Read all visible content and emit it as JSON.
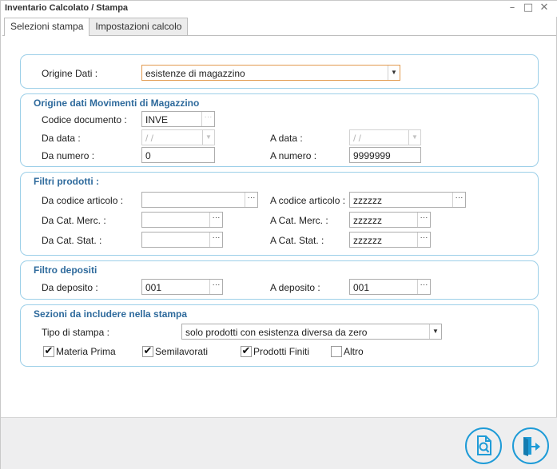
{
  "window": {
    "title": "Inventario Calcolato / Stampa",
    "minimize": "–",
    "maximize": "□",
    "close": "✕"
  },
  "tabs": [
    {
      "label": "Selezioni stampa",
      "active": true
    },
    {
      "label": "Impostazioni calcolo",
      "active": false
    }
  ],
  "origine": {
    "label": "Origine Dati :",
    "value": "esistenze di magazzino"
  },
  "movimenti": {
    "title": "Origine dati Movimenti di Magazzino",
    "codice_label": "Codice documento :",
    "codice_value": "INVE",
    "da_data_label": "Da data :",
    "da_data_value": " /  /",
    "a_data_label": "A data :",
    "a_data_value": " /  /",
    "da_numero_label": "Da numero :",
    "da_numero_value": "0",
    "a_numero_label": "A numero :",
    "a_numero_value": "9999999"
  },
  "filtri": {
    "title": "Filtri prodotti :",
    "da_cod_label": "Da codice articolo :",
    "da_cod_value": "",
    "a_cod_label": "A codice articolo :",
    "a_cod_value": "zzzzzz",
    "da_merc_label": "Da Cat. Merc. :",
    "da_merc_value": "",
    "a_merc_label": "A Cat. Merc. :",
    "a_merc_value": "zzzzzz",
    "da_stat_label": "Da Cat. Stat. :",
    "da_stat_value": "",
    "a_stat_label": "A Cat. Stat. :",
    "a_stat_value": "zzzzzz"
  },
  "depositi": {
    "title": "Filtro depositi",
    "da_label": "Da deposito :",
    "da_value": "001",
    "a_label": "A deposito :",
    "a_value": "001"
  },
  "sezioni": {
    "title": "Sezioni da includere nella stampa",
    "tipo_label": "Tipo di stampa :",
    "tipo_value": "solo prodotti con esistenza diversa da zero",
    "checks": [
      {
        "label": "Materia Prima",
        "checked": true
      },
      {
        "label": "Semilavorati",
        "checked": true
      },
      {
        "label": "Prodotti Finiti",
        "checked": true
      },
      {
        "label": "Altro",
        "checked": false
      }
    ]
  },
  "glyphs": {
    "dots": "···",
    "arrow": "▼",
    "check": "✔"
  },
  "footer": {
    "preview_icon": "print-preview-icon",
    "exit_icon": "exit-icon",
    "accent": "#1e9bd7"
  }
}
